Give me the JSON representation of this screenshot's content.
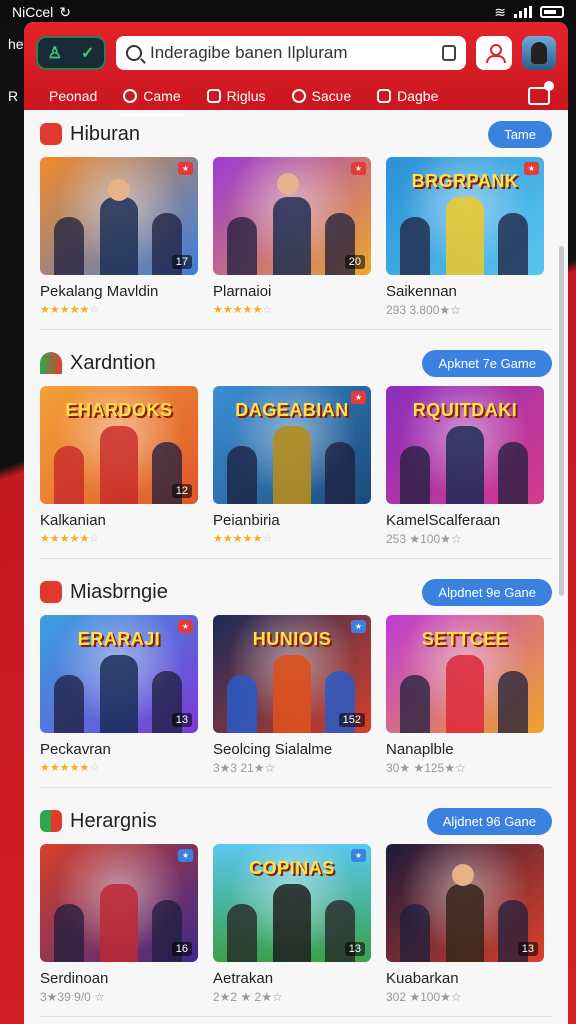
{
  "status": {
    "carrier": "NiCcel"
  },
  "side": {
    "top_label": "he",
    "mid_label": "R"
  },
  "search": {
    "placeholder": "Inderagibe banen Ilpluram"
  },
  "tabs": [
    {
      "label": "Peonad"
    },
    {
      "label": "Came"
    },
    {
      "label": "Riglus"
    },
    {
      "label": "Sacʋe"
    },
    {
      "label": "Dagbe"
    }
  ],
  "colors": {
    "brand_red": "#d6232b",
    "button_blue": "#3b82e0"
  },
  "sections": [
    {
      "title": "Hiburan",
      "button": "Tame",
      "cards": [
        {
          "title": "Pekalang Mavldin",
          "stars": 4,
          "badge_num": "17",
          "banner": ""
        },
        {
          "title": "Plarnaioi",
          "stars": 4,
          "badge_num": "20",
          "banner": ""
        },
        {
          "title": "Saikennan",
          "meta": "293 3.800★☆",
          "badge_num": "",
          "banner": "BRGRPANK"
        }
      ]
    },
    {
      "title": "Xardntion",
      "button": "Apknet 7e Game",
      "cards": [
        {
          "title": "Kalkanian",
          "stars": 4,
          "badge_num": "12",
          "banner": "EHARDOKS"
        },
        {
          "title": "Peianbiria",
          "stars": 5,
          "badge_num": "",
          "banner": "DAGEABIAN"
        },
        {
          "title": "KamelScalferaan",
          "meta": "253 ★100★☆",
          "badge_num": "",
          "banner": "RQUITDAKI"
        }
      ]
    },
    {
      "title": "Miasbrngie",
      "button": "Alpdnet 9e Gane",
      "cards": [
        {
          "title": "Peckavran",
          "stars": 4,
          "badge_num": "13",
          "banner": "ERARAJI"
        },
        {
          "title": "Seolcing Sialalme",
          "meta": "3★3 21★☆",
          "badge_num": "152",
          "banner": "HUNIOIS"
        },
        {
          "title": "Nanaplble",
          "meta": "30★ ★125★☆",
          "badge_num": "",
          "banner": "SETTCEE"
        }
      ]
    },
    {
      "title": "Herargnis",
      "button": "Aljdnet 96 Gane",
      "cards": [
        {
          "title": "Serdinoan",
          "meta": "3★39 9/0 ☆",
          "badge_num": "16",
          "banner": ""
        },
        {
          "title": "Aetrakan",
          "meta": "2★2 ★ 2★☆",
          "badge_num": "13",
          "banner": "COPINAS"
        },
        {
          "title": "Kuabarkan",
          "meta": "302 ★100★☆",
          "badge_num": "13",
          "banner": ""
        }
      ]
    }
  ]
}
